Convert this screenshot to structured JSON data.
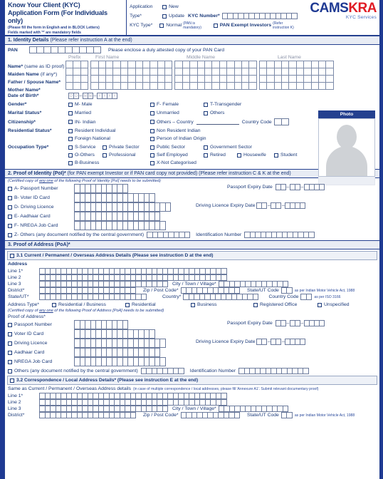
{
  "header": {
    "title_line1": "Know Your Client (KYC)",
    "title_line2": "Application Form (For Individuals only)",
    "subtitle_line1": "(Please fill the form in English and in BLOCK Letters)",
    "subtitle_line2": "Fields marked with '*' are mandatory fields",
    "application_type_label": "Application Type*",
    "application_type_label_l1": "Application",
    "application_type_label_l2": "Type*",
    "new_label": "New",
    "update_label": "Update",
    "kyc_number_label": "KYC Number*",
    "kyc_type_label": "KYC Type*",
    "normal_label": "Normal",
    "normal_note": "(PAN is mandatory)",
    "pan_exempt_label": "PAN Exempt Investors",
    "pan_exempt_note": "(Refer instruction K)",
    "logo_cams": "CAMS",
    "logo_kra": "KRA",
    "logo_sub": "KYC Services",
    "brand_blue": "#1f3a93",
    "brand_red": "#e01b24"
  },
  "section1": {
    "heading_bold": "1. Identity Details",
    "heading_rest": "(Please refer instruction A at the end)",
    "pan_label": "PAN",
    "pan_note": "Please enclose a duly attested copy of your PAN Card",
    "col_prefix": "Prefix",
    "col_first": "First Name",
    "col_middle": "Middle Name",
    "col_last": "Last Name",
    "rows": [
      {
        "label": "Name*",
        "sub": "(same as ID proof)"
      },
      {
        "label": "Maiden Name",
        "sub": "(if any*)"
      },
      {
        "label": "Father / Spouse Name*",
        "sub": ""
      },
      {
        "label": "Mother Name*",
        "sub": ""
      }
    ],
    "dob_label": "Date of Birth*",
    "dob_dd": [
      "D",
      "D"
    ],
    "dob_mm": [
      "M",
      "M"
    ],
    "dob_yyyy": [
      "Y",
      "Y",
      "Y",
      "Y"
    ],
    "gender_label": "Gender*",
    "gender_options": [
      "M- Male",
      "F- Female",
      "T-Transgender"
    ],
    "marital_label": "Marital Status*",
    "marital_options": [
      "Married",
      "Unmarried",
      "Others"
    ],
    "citizenship_label": "Citizenship*",
    "citizenship_in": "IN- Indian",
    "citizenship_others": "Others – Country",
    "country_code_label": "Country Code",
    "residential_label": "Residential Status*",
    "residential_r1": [
      "Resident Individual",
      "Non Resident Indian"
    ],
    "residential_r2": [
      "Foreign National",
      "Person of Indian Origin"
    ],
    "occupation_label": "Occupation Type*",
    "occupation_r1": [
      "S-Service",
      "Private Sector",
      "Public Sector",
      "Government Sector"
    ],
    "occupation_r2": [
      "O-Others",
      "Professional",
      "Self Employed",
      "Retired",
      "Housewife",
      "Student"
    ],
    "occupation_r3": [
      "B-Business",
      "X-Not Categorised"
    ],
    "photo_label": "Photo"
  },
  "section2": {
    "heading_bold": "2. Proof of Identity (PoI)*",
    "heading_rest": "(for PAN exempt Investor or if PAN card copy not provided) (Please refer instruction C & K at the end)",
    "note_pre": "(Certified copy of ",
    "note_u": "any one",
    "note_post": " of the following Proof of Identity [PoI] needs to be submitted)",
    "items": [
      {
        "label": "A- Passport Number",
        "cells": 10
      },
      {
        "label": "B- Voter ID Card",
        "cells": 15
      },
      {
        "label": "D- Driving Licence",
        "cells": 18
      },
      {
        "label": "E- Aadhaar Card",
        "cells": 16
      },
      {
        "label": "F- NREGA Job Card",
        "cells": 17
      }
    ],
    "others_label": "Z- Others (any document notified by the central government)",
    "others_cells": 8,
    "ident_label": "Identification Number",
    "ident_cells": 13,
    "passport_expiry_label": "Passport Expiry Date",
    "dl_expiry_label": "Driving Licence Expiry Date"
  },
  "section3": {
    "heading": "3. Proof of Address (PoA)*",
    "sub31": "3.1 Current / Permanent / Overseas Address Details (Please see instruction D at the end)",
    "address_label": "Address",
    "line1_label": "Line 1*",
    "line2_label": "Line 2",
    "line3_label": "Line 3",
    "city_label": "City / Town / Village*",
    "district_label": "District*",
    "zip_label": "Zip / Post Code*",
    "stateut_code_label": "State/UT Code",
    "stateut_note": "as per Indian Motor Vehicle Act, 1988",
    "stateut_label": "State/UT*",
    "country_label": "Country*",
    "country_code_label": "Country Code",
    "country_note": "as per ISO 3166",
    "address_type_label": "Address Type*",
    "address_types": [
      "Residential / Business",
      "Residential",
      "Business",
      "Registered Office",
      "Unspecified"
    ],
    "poa_note_pre": "(Certified copy of ",
    "poa_note_u": "any one",
    "poa_note_post": " of the following Proof of Address [PoA] needs to be submitted)",
    "poa_label": "Proof of Address*",
    "poa_items": [
      {
        "label": "Passport Number",
        "cells": 10
      },
      {
        "label": "Voter ID Card",
        "cells": 15
      },
      {
        "label": "Driving Licence",
        "cells": 17
      },
      {
        "label": "Aadhaar Card",
        "cells": 16
      },
      {
        "label": "NREGA Job Card",
        "cells": 17
      }
    ],
    "poa_others_label": "Others (any document notified by the central government)",
    "poa_ident_label": "Identification Number",
    "passport_expiry_label": "Passport Expiry Date",
    "dl_expiry_label": "Driving Licence Expiry Date",
    "sub32": "3.2 Correspondence / Local Address Details* (Please see instruction E at the end)",
    "same_as_label": "Same as Current / Permanent / Overseas Address details",
    "same_as_note": "(in case of multiple correspondence / local addresses, please fill 'Annexure A1'. Submit relevant documentary proof)"
  }
}
